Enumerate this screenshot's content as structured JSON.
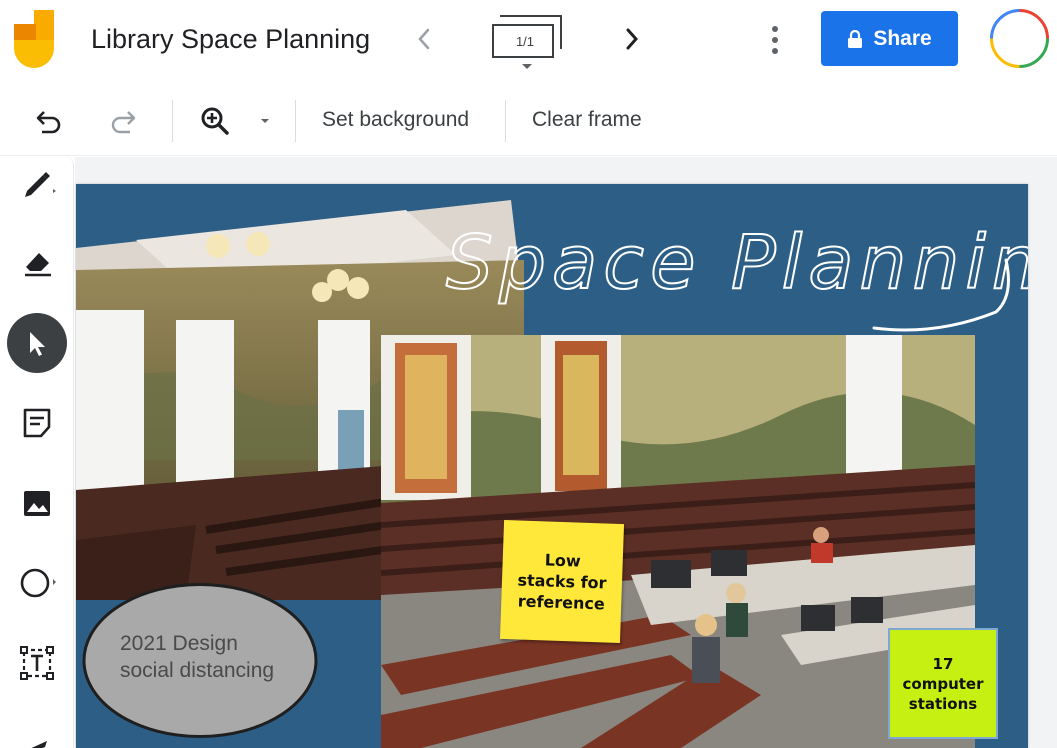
{
  "app": {
    "title": "Library Space Planning",
    "frame_counter": "1/1",
    "share_label": "Share",
    "colors": {
      "accent": "#1a73e8",
      "frame_background": "#2c5e86"
    }
  },
  "toolbar": {
    "set_background_label": "Set background",
    "clear_frame_label": "Clear frame"
  },
  "tools": [
    {
      "icon": "pen-icon"
    },
    {
      "icon": "eraser-icon"
    },
    {
      "icon": "select-arrow-icon",
      "active": true
    },
    {
      "icon": "sticky-note-icon"
    },
    {
      "icon": "image-icon"
    },
    {
      "icon": "circle-shape-icon"
    },
    {
      "icon": "text-box-icon"
    },
    {
      "icon": "laser-icon"
    }
  ],
  "canvas": {
    "handwriting_title": "Space Planning",
    "ellipse_note": {
      "line1": "2021 Design",
      "line2": "social distancing"
    },
    "sticky_yellow": {
      "line1": "Low",
      "line2": "stacks for",
      "line3": "reference",
      "color": "#ffe83a"
    },
    "sticky_green": {
      "line1": "17",
      "line2": "computer",
      "line3": "stations",
      "color": "#c6ef12"
    }
  }
}
